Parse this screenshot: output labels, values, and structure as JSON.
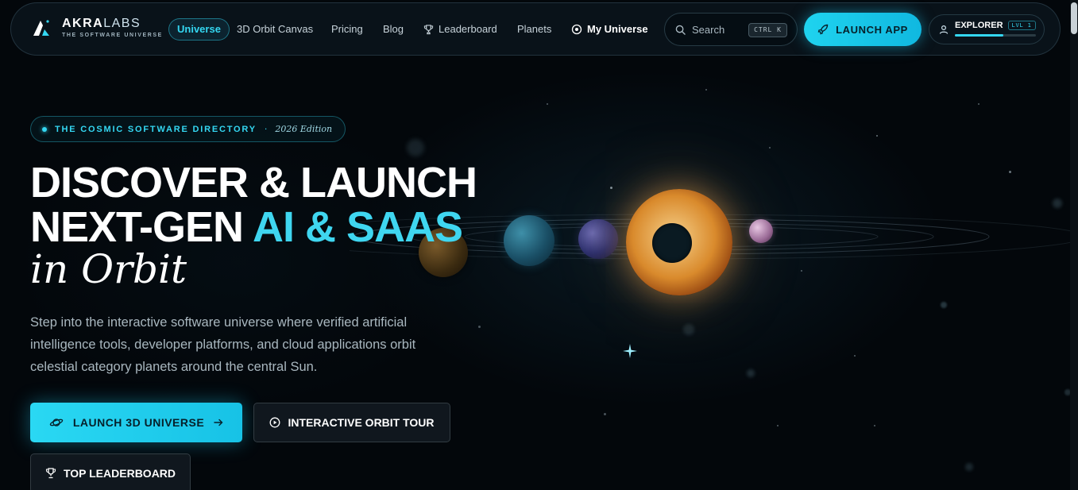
{
  "brand": {
    "name_main": "AKRA",
    "name_accent": "LABS",
    "tagline": "THE SOFTWARE UNIVERSE"
  },
  "nav": {
    "items": [
      {
        "label": "Universe",
        "active": true
      },
      {
        "label": "3D Orbit Canvas"
      },
      {
        "label": "Pricing"
      },
      {
        "label": "Blog"
      },
      {
        "label": "Leaderboard",
        "icon": "trophy-icon"
      },
      {
        "label": "Planets"
      },
      {
        "label": "My Universe",
        "icon": "planet-ring-icon"
      }
    ],
    "search_label": "Search",
    "search_shortcut": "CTRL K",
    "launch_label": "LAUNCH APP",
    "user_name": "EXPLORER",
    "user_level": "LVL 1",
    "xp_progress": 0.6
  },
  "hero": {
    "badge_text": "THE COSMIC SOFTWARE DIRECTORY",
    "badge_separator": "·",
    "badge_edition": "2026 Edition",
    "headline_line1": "DISCOVER & LAUNCH",
    "headline_line2_prefix": "NEXT-GEN ",
    "headline_line2_accent": "AI & SAAS",
    "headline_line3": "in Orbit",
    "description": "Step into the interactive software universe where verified artificial intelligence tools, developer platforms, and cloud applications orbit celestial category planets around the central Sun.",
    "cta_primary": "LAUNCH 3D UNIVERSE",
    "cta_secondary": "INTERACTIVE ORBIT TOUR",
    "cta_tertiary": "TOP LEADERBOARD"
  },
  "colors": {
    "accent": "#34d7f2",
    "background": "#03070b"
  }
}
